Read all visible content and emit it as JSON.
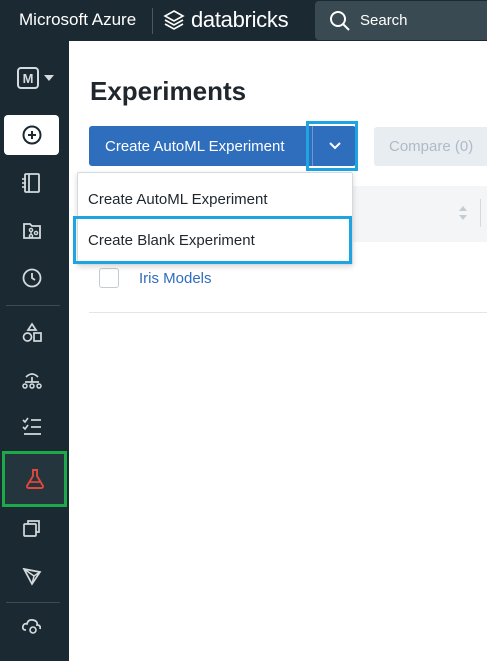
{
  "topbar": {
    "brand": "Microsoft Azure",
    "product": "databricks",
    "search_label": "Search"
  },
  "sidebar": {
    "workspace_letter": "M",
    "items": [
      {
        "name": "create",
        "icon": "plus-circle-icon",
        "active": true
      },
      {
        "name": "workspace",
        "icon": "notebook-icon"
      },
      {
        "name": "repos",
        "icon": "repo-icon"
      },
      {
        "name": "recents",
        "icon": "clock-icon"
      },
      {
        "name": "data",
        "icon": "shapes-icon"
      },
      {
        "name": "clusters",
        "icon": "cluster-icon"
      },
      {
        "name": "jobs",
        "icon": "checklist-icon"
      },
      {
        "name": "experiments",
        "icon": "flask-icon",
        "active": true
      },
      {
        "name": "feature-store",
        "icon": "stack-icon"
      },
      {
        "name": "models",
        "icon": "model-icon"
      },
      {
        "name": "serving",
        "icon": "cloud-icon"
      }
    ]
  },
  "main": {
    "title": "Experiments",
    "create_button": "Create AutoML Experiment",
    "compare_button": "Compare (0)",
    "rows": [
      {
        "name": "Iris Models"
      }
    ]
  },
  "dropdown": {
    "items": [
      "Create AutoML Experiment",
      "Create Blank Experiment"
    ]
  },
  "colors": {
    "sidebar_bg": "#1b2a32",
    "primary": "#2f6dbd",
    "highlight_blue": "#1ea4e0",
    "highlight_green": "#1da84a",
    "flask_red": "#e0483c"
  }
}
